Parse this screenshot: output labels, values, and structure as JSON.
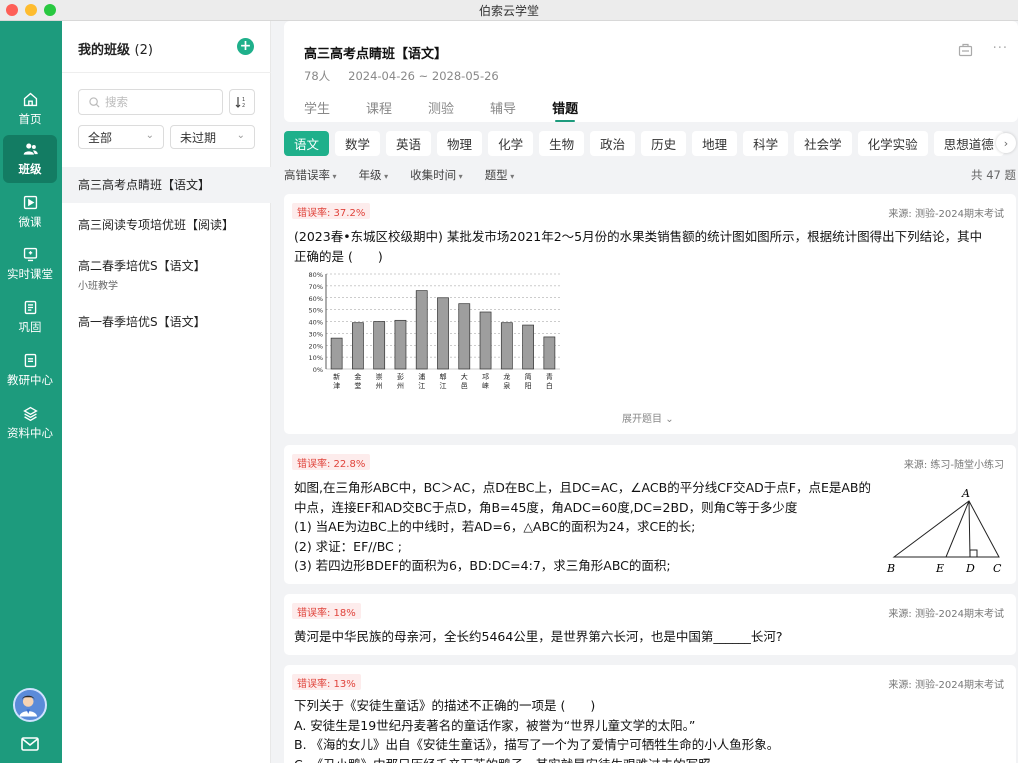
{
  "window": {
    "title": "伯索云学堂"
  },
  "nav": {
    "items": [
      {
        "label": "首页",
        "icon": "home-icon",
        "active": false
      },
      {
        "label": "班级",
        "icon": "users-icon",
        "active": true
      },
      {
        "label": "微课",
        "icon": "video-icon",
        "active": false
      },
      {
        "label": "实时课堂",
        "icon": "live-class-icon",
        "active": false
      },
      {
        "label": "巩固",
        "icon": "review-icon",
        "active": false
      },
      {
        "label": "教研中心",
        "icon": "research-icon",
        "active": false
      },
      {
        "label": "资料中心",
        "icon": "layers-icon",
        "active": false
      }
    ]
  },
  "class_panel": {
    "title": "我的班级",
    "count": "(2)",
    "search_placeholder": "搜索",
    "sort_label": "↓z",
    "filter_scope": "全部",
    "filter_expiry": "未过期",
    "classes": [
      {
        "name": "高三高考点睛班【语文】",
        "sub": "",
        "active": true
      },
      {
        "name": "高三阅读专项培优班【阅读】",
        "sub": "",
        "active": false
      },
      {
        "name": "高二春季培优S【语文】",
        "sub": "小班教学",
        "active": false
      },
      {
        "name": "高一春季培优S【语文】",
        "sub": "",
        "active": false
      }
    ]
  },
  "header": {
    "class_title": "高三高考点睛班【语文】",
    "students": "78人",
    "date_range": "2024-04-26 ~ 2028-05-26",
    "tabs": [
      "学生",
      "课程",
      "测验",
      "辅导",
      "错题"
    ],
    "active_tab": "错题"
  },
  "subjects": [
    "语文",
    "数学",
    "英语",
    "物理",
    "化学",
    "生物",
    "政治",
    "历史",
    "地理",
    "科学",
    "社会学",
    "化学实验",
    "思想道德"
  ],
  "active_subject": "语文",
  "filters": {
    "items": [
      "高错误率",
      "年级",
      "收集时间",
      "题型"
    ],
    "total": "共 47 题"
  },
  "questions": [
    {
      "rate": "错误率: 37.2%",
      "source": "来源: 测验-2024期末考试",
      "lines": [
        "(2023春•东城区校级期中) 某批发市场2021年2～5月份的水果类销售额的统计图如图所示，根据统计图得出下列结论，其中",
        "正确的是 (　　)"
      ],
      "expand": "展开题目"
    },
    {
      "rate": "错误率: 22.8%",
      "source": "来源: 练习-随堂小练习",
      "lines": [
        "如图,在三角形ABC中，BC＞AC，点D在BC上，且DC=AC，∠ACB的平分线CF交AD于点F，点E是AB的",
        "中点，连接EF和AD交BC于点D，角B=45度，角ADC=60度,DC=2BD，则角C等于多少度",
        "(1) 当AE为边BC上的中线时，若AD=6，△ABC的面积为24，求CE的长;",
        "(2) 求证：EF//BC ;",
        "(3) 若四边形BDEF的面积为6，BD:DC=4:7，求三角形ABC的面积;"
      ],
      "figure_labels": {
        "A": "A",
        "B": "B",
        "E": "E",
        "D": "D",
        "C": "C"
      }
    },
    {
      "rate": "错误率: 18%",
      "source": "来源: 测验-2024期末考试",
      "lines": [
        "黄河是中华民族的母亲河，全长约5464公里，是世界第六长河，也是中国第______长河?"
      ]
    },
    {
      "rate": "错误率: 13%",
      "source": "来源: 测验-2024期末考试",
      "lines": [
        "下列关于《安徒生童话》的描述不正确的一项是 (　　)",
        "A. 安徒生是19世纪丹麦著名的童话作家，被誉为“世界儿童文学的太阳。”",
        "B. 《海的女儿》出自《安徒生童话》，描写了一个为了爱情宁可牺牲生命的小人鱼形象。",
        "C. 《丑小鸭》中那只历经千辛万苦的鸭子，其实就是安徒生艰难过去的写照。"
      ]
    }
  ],
  "chart_data": {
    "type": "bar",
    "categories": [
      "新津",
      "金堂",
      "崇州",
      "彭州",
      "浦江",
      "郫江",
      "大邑",
      "邛崃",
      "龙泉",
      "简阳",
      "青白"
    ],
    "values": [
      26,
      39,
      40,
      41,
      66,
      60,
      55,
      48,
      39,
      37,
      27
    ],
    "ylim": [
      0,
      80
    ],
    "yticks": [
      "0%",
      "10%",
      "20%",
      "30%",
      "40%",
      "50%",
      "60%",
      "70%",
      "80%"
    ],
    "grid": true
  }
}
